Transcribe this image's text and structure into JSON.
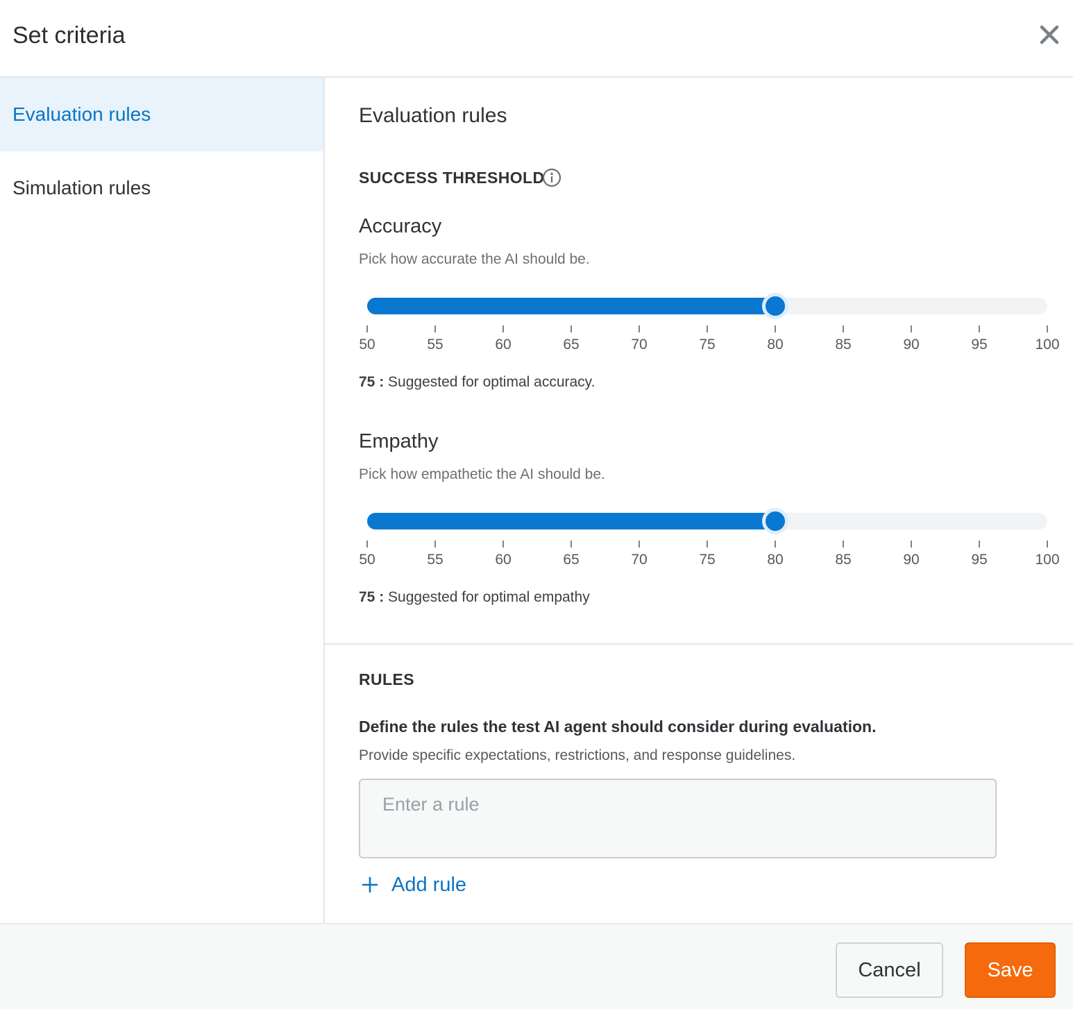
{
  "dialog": {
    "title": "Set criteria",
    "close_icon": "close-icon"
  },
  "sidebar": {
    "items": [
      {
        "label": "Evaluation rules",
        "active": true
      },
      {
        "label": "Simulation rules",
        "active": false
      }
    ]
  },
  "main": {
    "title": "Evaluation rules",
    "threshold": {
      "heading": "SUCCESS THRESHOLD",
      "info_icon": "info-icon",
      "sliders": [
        {
          "label": "Accuracy",
          "description": "Pick how accurate the AI should be.",
          "min": 50,
          "max": 100,
          "step": 5,
          "value": 80,
          "ticks": [
            "50",
            "55",
            "60",
            "65",
            "70",
            "75",
            "80",
            "85",
            "90",
            "95",
            "100"
          ],
          "suggested_value": "75 :",
          "suggested_text": " Suggested for optimal accuracy."
        },
        {
          "label": "Empathy",
          "description": "Pick how empathetic the AI should be.",
          "min": 50,
          "max": 100,
          "step": 5,
          "value": 80,
          "ticks": [
            "50",
            "55",
            "60",
            "65",
            "70",
            "75",
            "80",
            "85",
            "90",
            "95",
            "100"
          ],
          "suggested_value": "75 :",
          "suggested_text": " Suggested for optimal empathy"
        }
      ]
    },
    "rules": {
      "heading": "RULES",
      "bold_text": "Define the rules the test AI agent should consider during evaluation.",
      "description": "Provide specific expectations, restrictions, and response guidelines.",
      "input_placeholder": "Enter a rule",
      "input_value": "",
      "add_rule_label": "Add rule",
      "add_icon": "plus-icon"
    }
  },
  "footer": {
    "cancel_label": "Cancel",
    "save_label": "Save"
  },
  "colors": {
    "accent": "#0a78d1",
    "active_nav_bg": "#e8f3fb",
    "primary_button": "#f56a0d"
  }
}
